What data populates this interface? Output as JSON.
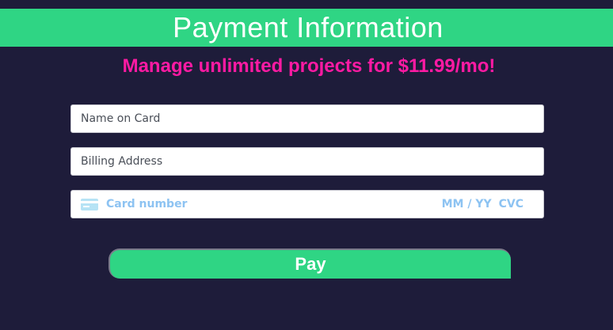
{
  "header": {
    "title": "Payment Information"
  },
  "promo": {
    "text": "Manage unlimited projects for $11.99/mo!"
  },
  "form": {
    "name_placeholder": "Name on Card",
    "address_placeholder": "Billing Address",
    "card": {
      "icon": "credit-card-icon",
      "number_placeholder": "Card number",
      "exp_placeholder": "MM / YY",
      "cvc_placeholder": "CVC"
    },
    "pay_label": "Pay"
  },
  "colors": {
    "background": "#1e1c3a",
    "accent_green": "#2fd584",
    "promo_pink": "#ff1aa3",
    "card_placeholder_blue": "#8dc3f2"
  }
}
